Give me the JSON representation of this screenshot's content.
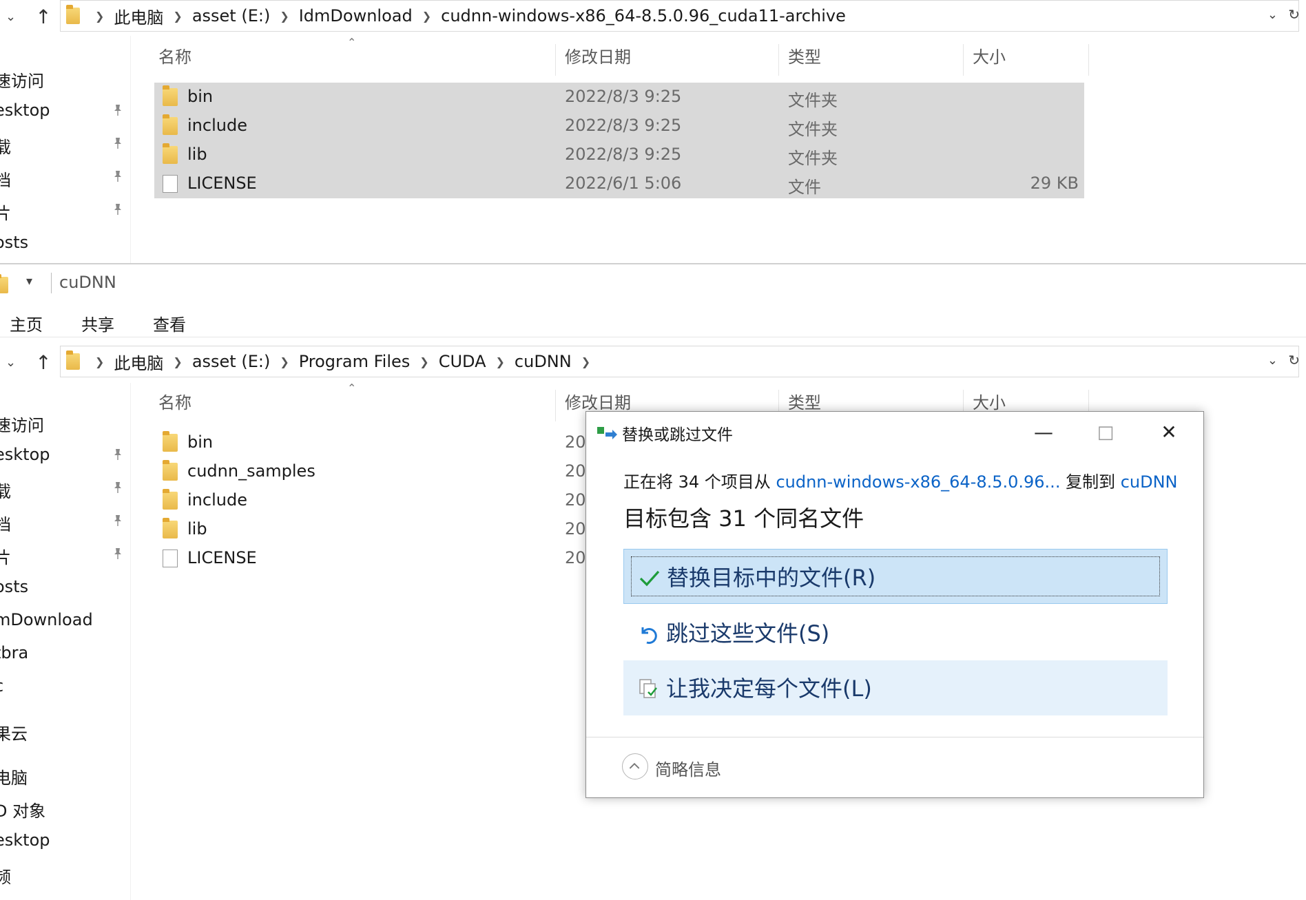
{
  "top_window": {
    "breadcrumbs": [
      "此电脑",
      "asset (E:)",
      "IdmDownload",
      "cudnn-windows-x86_64-8.5.0.96_cuda11-archive"
    ],
    "nav_items": [
      "速访问",
      "esktop",
      "载",
      "档",
      "片",
      "osts"
    ],
    "columns": {
      "name": "名称",
      "date": "修改日期",
      "type": "类型",
      "size": "大小"
    },
    "files": [
      {
        "name": "bin",
        "date": "2022/8/3 9:25",
        "type": "文件夹",
        "size": "",
        "icon": "folder-icon"
      },
      {
        "name": "include",
        "date": "2022/8/3 9:25",
        "type": "文件夹",
        "size": "",
        "icon": "folder-icon"
      },
      {
        "name": "lib",
        "date": "2022/8/3 9:25",
        "type": "文件夹",
        "size": "",
        "icon": "folder-icon"
      },
      {
        "name": "LICENSE",
        "date": "2022/6/1 5:06",
        "type": "文件",
        "size": "29 KB",
        "icon": "file-icon"
      }
    ]
  },
  "bottom_window": {
    "title": "cuDNN",
    "ribbon_tabs": [
      "主页",
      "共享",
      "查看"
    ],
    "breadcrumbs": [
      "此电脑",
      "asset (E:)",
      "Program Files",
      "CUDA",
      "cuDNN"
    ],
    "nav_items": [
      "速访问",
      "esktop",
      "载",
      "档",
      "片",
      "osts",
      "mDownload",
      "tbra",
      "c",
      "果云",
      "电脑",
      "D 对象",
      "esktop",
      "频"
    ],
    "columns": {
      "name": "名称",
      "date": "修改日期",
      "type": "类型",
      "size": "大小"
    },
    "files": [
      {
        "name": "bin",
        "date": "20",
        "icon": "folder-icon"
      },
      {
        "name": "cudnn_samples",
        "date": "20",
        "icon": "folder-icon"
      },
      {
        "name": "include",
        "date": "20",
        "icon": "folder-icon"
      },
      {
        "name": "lib",
        "date": "20",
        "icon": "folder-icon"
      },
      {
        "name": "LICENSE",
        "date": "20",
        "icon": "file-icon"
      }
    ]
  },
  "dialog": {
    "title": "替换或跳过文件",
    "line1_prefix": "正在将 34 个项目从 ",
    "line1_source": "cudnn-windows-x86_64-8.5.0.96...",
    "line1_middle": " 复制到 ",
    "line1_dest": "cuDNN",
    "line2": "目标包含 31 个同名文件",
    "options": [
      "替换目标中的文件(R)",
      "跳过这些文件(S)",
      "让我决定每个文件(L)"
    ],
    "footer": "简略信息",
    "colors": {
      "link": "#0b63c7",
      "selected_option": "#cce4f7",
      "hover_option": "#e5f1fb",
      "row_selected": "#d9d9d9"
    }
  }
}
